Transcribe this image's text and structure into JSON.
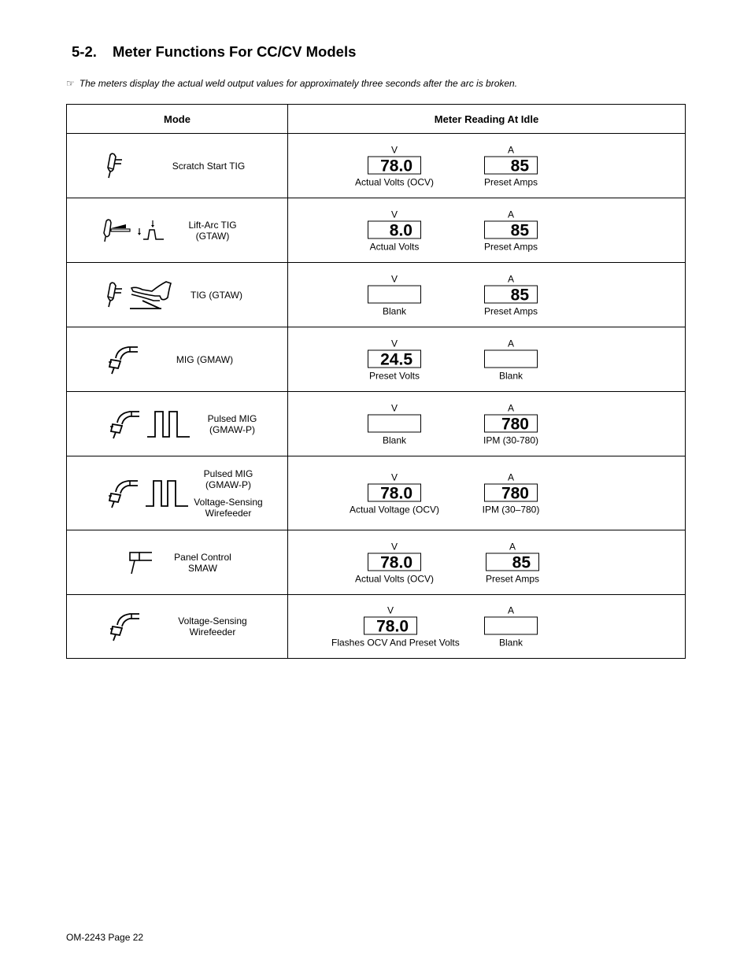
{
  "section": {
    "number": "5-2.",
    "title": "Meter Functions For CC/CV Models"
  },
  "note": {
    "icon": "pointing-hand-icon",
    "text": "The meters display the actual weld output values for approximately three seconds after the arc is broken."
  },
  "table": {
    "headers": {
      "mode": "Mode",
      "reading": "Meter Reading At Idle"
    },
    "rows": [
      {
        "mode": "Scratch Start TIG",
        "mode2": "",
        "icons": [
          "tig-torch-icon"
        ],
        "volts": {
          "unit": "V",
          "value": "78.0",
          "caption": "Actual Volts (OCV)"
        },
        "amps": {
          "unit": "A",
          "value": "85",
          "caption": "Preset Amps"
        }
      },
      {
        "mode": "Lift-Arc TIG",
        "mode2": "(GTAW)",
        "icons": [
          "tig-torch-workpiece-icon",
          "lift-arc-waveform-icon"
        ],
        "volts": {
          "unit": "V",
          "value": "8.0",
          "caption": "Actual Volts"
        },
        "amps": {
          "unit": "A",
          "value": "85",
          "caption": "Preset Amps"
        }
      },
      {
        "mode": "TIG (GTAW)",
        "mode2": "",
        "icons": [
          "tig-torch-icon",
          "foot-pedal-icon"
        ],
        "volts": {
          "unit": "V",
          "value": "",
          "caption": "Blank"
        },
        "amps": {
          "unit": "A",
          "value": "85",
          "caption": "Preset Amps"
        }
      },
      {
        "mode": "MIG (GMAW)",
        "mode2": "",
        "icons": [
          "mig-gun-icon"
        ],
        "volts": {
          "unit": "V",
          "value": "24.5",
          "caption": "Preset Volts"
        },
        "amps": {
          "unit": "A",
          "value": "",
          "caption": "Blank"
        }
      },
      {
        "mode": "Pulsed MIG",
        "mode2": "(GMAW-P)",
        "icons": [
          "mig-gun-icon",
          "pulse-waveform-icon"
        ],
        "volts": {
          "unit": "V",
          "value": "",
          "caption": "Blank"
        },
        "amps": {
          "unit": "A",
          "value": "780",
          "caption": "IPM (30-780)"
        }
      },
      {
        "mode": "Pulsed MIG",
        "mode2": "(GMAW-P)",
        "mode3": "Voltage-Sensing",
        "mode4": "Wirefeeder",
        "icons": [
          "mig-gun-icon",
          "pulse-waveform-icon"
        ],
        "volts": {
          "unit": "V",
          "value": "78.0",
          "caption": "Actual Voltage (OCV)"
        },
        "amps": {
          "unit": "A",
          "value": "780",
          "caption": "IPM (30–780)"
        }
      },
      {
        "mode": "Panel Control",
        "mode2": "SMAW",
        "icons": [
          "stick-electrode-holder-icon"
        ],
        "volts": {
          "unit": "V",
          "value": "78.0",
          "caption": "Actual Volts (OCV)"
        },
        "amps": {
          "unit": "A",
          "value": "85",
          "caption": "Preset Amps"
        }
      },
      {
        "mode": "Voltage-Sensing",
        "mode2": "Wirefeeder",
        "icons": [
          "mig-gun-icon"
        ],
        "volts": {
          "unit": "V",
          "value": "78.0",
          "caption": "Flashes OCV And Preset Volts"
        },
        "amps": {
          "unit": "A",
          "value": "",
          "caption": "Blank"
        }
      }
    ]
  },
  "footer": {
    "text": "OM-2243 Page 22"
  }
}
